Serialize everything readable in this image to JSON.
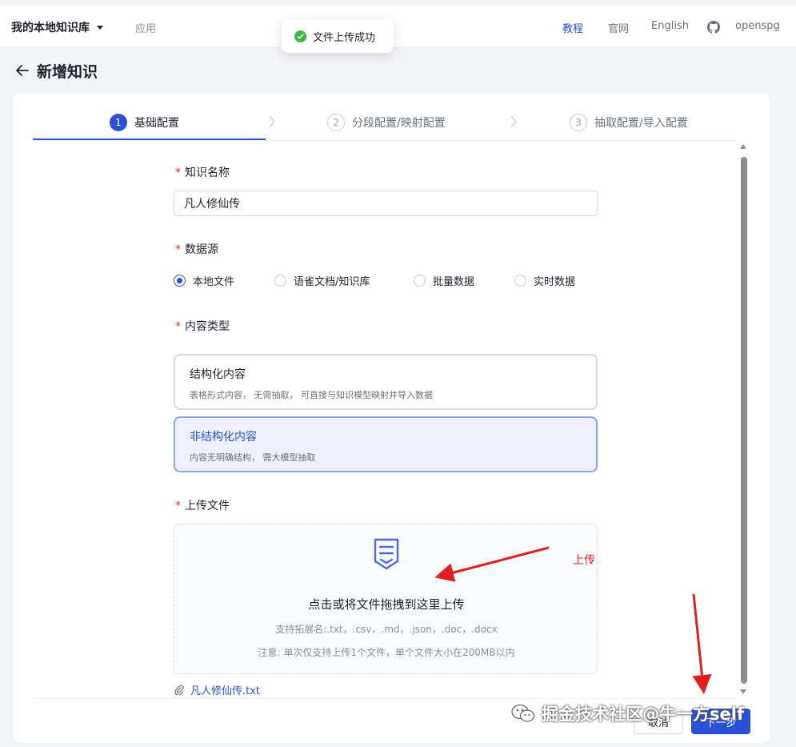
{
  "topnav": {
    "kb_name": "我的本地知识库",
    "app_label": "应用",
    "links": [
      "教程",
      "官网",
      "English",
      "openspg"
    ],
    "icons": [
      "github-icon"
    ]
  },
  "toast": {
    "message": "文件上传成功",
    "icon": "success-check-icon",
    "color": "#3fb443"
  },
  "page": {
    "title": "新增知识"
  },
  "steps": [
    {
      "num": "1",
      "label": "基础配置",
      "active": true
    },
    {
      "num": "2",
      "label": "分段配置/映射配置",
      "active": false
    },
    {
      "num": "3",
      "label": "抽取配置/导入配置",
      "active": false
    }
  ],
  "form": {
    "name_label": "知识名称",
    "name_value": "凡人修仙传",
    "source_label": "数据源",
    "sources": [
      "本地文件",
      "语雀文档/知识库",
      "批量数据",
      "实时数据"
    ],
    "source_selected": "本地文件",
    "content_type_label": "内容类型",
    "content_types": [
      {
        "title": "结构化内容",
        "desc": "表格形式内容， 无需抽取， 可直接与知识模型映射并导入数据"
      },
      {
        "title": "非结构化内容",
        "desc": "内容无明确结构， 需大模型抽取"
      }
    ],
    "content_type_selected": "非结构化内容",
    "upload_label": "上传文件",
    "upload_title": "点击或将文件拖拽到这里上传",
    "upload_ext": "支持拓展名:.txt，.csv，.md，.json，.doc，.docx",
    "upload_note": "注意: 单次仅支持上传1个文件，单个文件大小在200MB以内",
    "uploaded_file": "凡人修仙传.txt"
  },
  "footer": {
    "cancel": "取消",
    "next": "下一步"
  },
  "annotations": {
    "upload_text": "上传",
    "color": "#e02020"
  },
  "watermark": {
    "text": "掘金技术社区@牛一方self"
  },
  "colors": {
    "primary": "#2b50d8",
    "required": "#e03030",
    "selected_bg": "#eef1fd"
  }
}
